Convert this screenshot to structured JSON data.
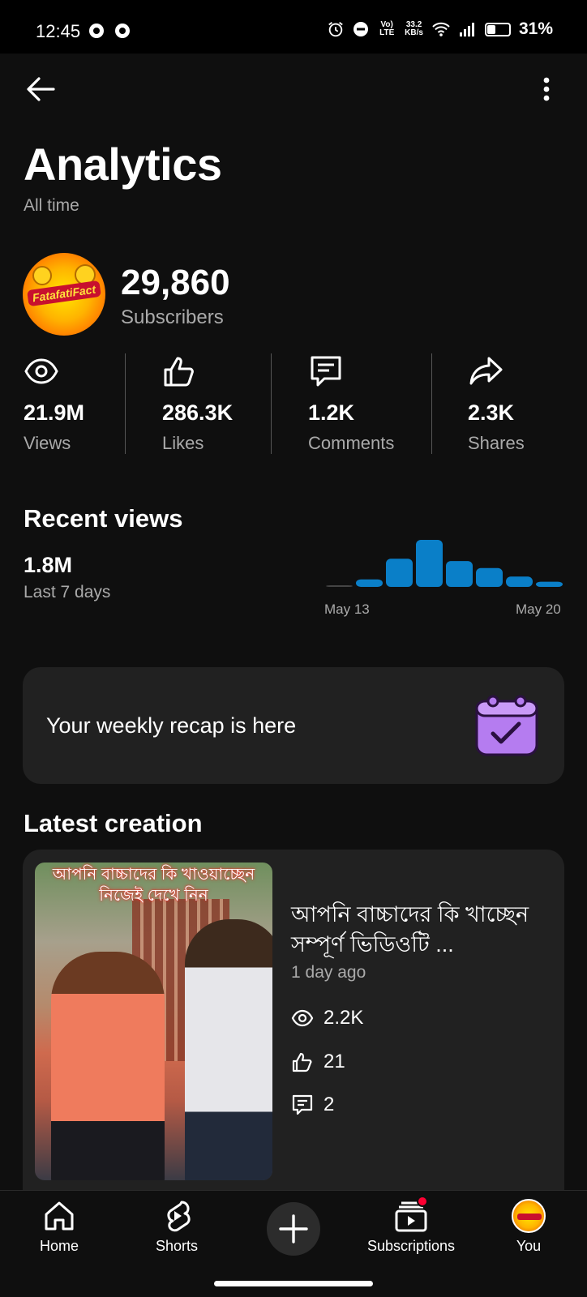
{
  "status_bar": {
    "time": "12:45",
    "lte": "Vo) LTE",
    "speed_value": "33.2",
    "speed_unit": "KB/s",
    "battery_percent": "31%"
  },
  "header": {
    "title": "Analytics",
    "subtitle": "All time"
  },
  "channel": {
    "avatar_text": "FatafatiFact",
    "subscribers_count": "29,860",
    "subscribers_label": "Subscribers"
  },
  "stats": [
    {
      "icon": "eye-icon",
      "value": "21.9M",
      "label": "Views"
    },
    {
      "icon": "thumbs-up-icon",
      "value": "286.3K",
      "label": "Likes"
    },
    {
      "icon": "comment-icon",
      "value": "1.2K",
      "label": "Comments"
    },
    {
      "icon": "share-icon",
      "value": "2.3K",
      "label": "Shares"
    }
  ],
  "recent_views": {
    "title": "Recent views",
    "value": "1.8M",
    "period_label": "Last 7 days",
    "x_start_label": "May 13",
    "x_end_label": "May 20"
  },
  "chart_data": {
    "type": "bar",
    "categories": [
      "",
      "",
      "",
      "",
      "",
      "",
      "",
      ""
    ],
    "values": [
      0.03,
      0.16,
      0.6,
      1.0,
      0.55,
      0.4,
      0.22,
      0.11
    ],
    "x_labels": [
      "May 13",
      "May 20"
    ],
    "ylim": [
      0,
      1
    ],
    "grid": false,
    "colors": {
      "bar": "#0a7fc8",
      "first_bar": "#444444"
    }
  },
  "recap": {
    "text": "Your weekly recap is here",
    "icon": "calendar-check-icon",
    "icon_color": "#b57cf0"
  },
  "latest_creation": {
    "section_title": "Latest creation",
    "thumbnail_caption_line1": "আপনি বাচ্চাদের কি খাওয়াচ্ছেন",
    "thumbnail_caption_line2": "নিজেই দেখে নিন",
    "video_title": "আপনি বাচ্চাদের কি খাচ্ছেন সম্পূর্ণ ভিডিওটি ...",
    "age": "1 day ago",
    "views": "2.2K",
    "likes": "21",
    "comments": "2"
  },
  "bottom_nav": {
    "home": "Home",
    "shorts": "Shorts",
    "subscriptions": "Subscriptions",
    "you": "You"
  },
  "colors": {
    "background": "#0f0f0f",
    "card": "#212121",
    "secondary_text": "#aaaaaa",
    "accent_red": "#ff0033"
  }
}
